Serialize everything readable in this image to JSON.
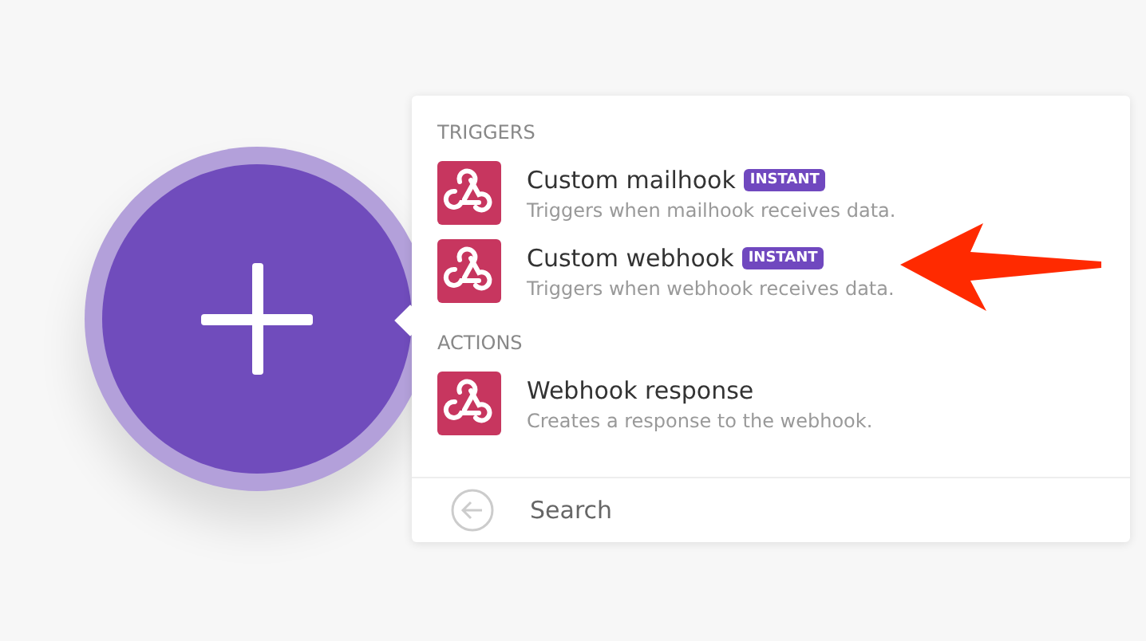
{
  "sections": [
    {
      "heading": "TRIGGERS",
      "items": [
        {
          "title": "Custom mailhook",
          "badge": "INSTANT",
          "description": "Triggers when mailhook receives data."
        },
        {
          "title": "Custom webhook",
          "badge": "INSTANT",
          "description": "Triggers when webhook receives data."
        }
      ]
    },
    {
      "heading": "ACTIONS",
      "items": [
        {
          "title": "Webhook response",
          "description": "Creates a response to the webhook."
        }
      ]
    }
  ],
  "search": {
    "placeholder": "Search"
  }
}
